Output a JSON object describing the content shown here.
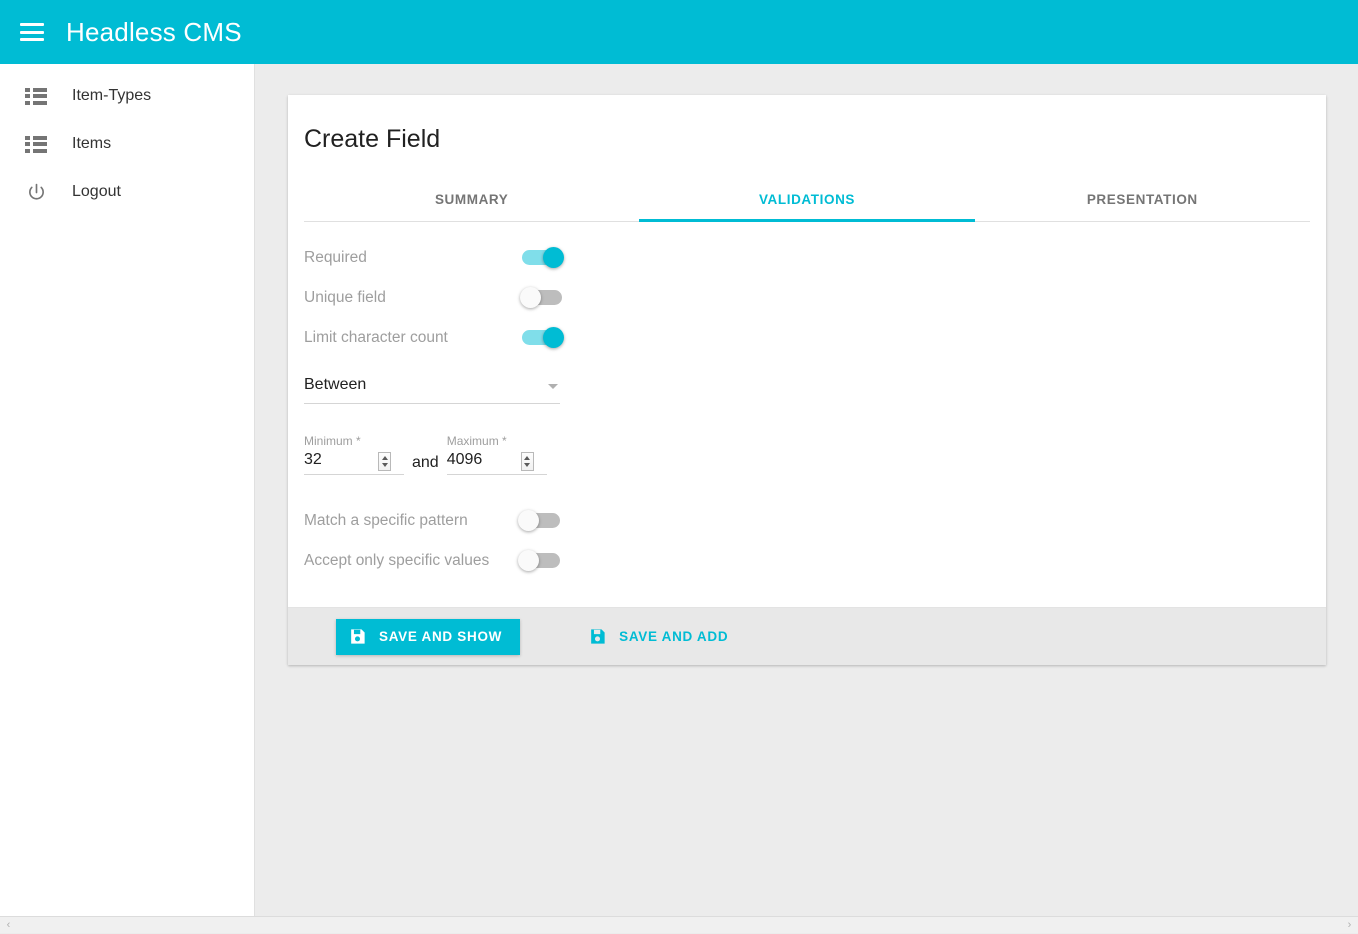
{
  "appbar": {
    "title": "Headless CMS",
    "menu_icon": "hamburger-icon",
    "brand_color": "#00bcd4"
  },
  "sidebar": {
    "items": [
      {
        "label": "Item-Types",
        "icon": "list-icon"
      },
      {
        "label": "Items",
        "icon": "list-icon"
      },
      {
        "label": "Logout",
        "icon": "power-icon"
      }
    ]
  },
  "card": {
    "title": "Create Field",
    "tabs": [
      {
        "label": "SUMMARY",
        "active": false
      },
      {
        "label": "VALIDATIONS",
        "active": true
      },
      {
        "label": "PRESENTATION",
        "active": false
      }
    ],
    "switches_top": [
      {
        "label": "Required",
        "state": "on"
      },
      {
        "label": "Unique field",
        "state": "off"
      },
      {
        "label": "Limit character count",
        "state": "on"
      }
    ],
    "limit_mode": {
      "value": "Between",
      "caret_icon": "chevron-down-icon"
    },
    "range": {
      "min_label": "Minimum *",
      "min_value": "32",
      "conjunction": "and",
      "max_label": "Maximum *",
      "max_value": "4096"
    },
    "switches_bottom": [
      {
        "label": "Match a specific pattern",
        "state": "off"
      },
      {
        "label": "Accept only specific values",
        "state": "off"
      }
    ],
    "footer": {
      "save_show_label": "SAVE AND SHOW",
      "save_add_label": "SAVE AND ADD",
      "save_icon": "floppy-disk-icon"
    }
  },
  "scrollbar": {
    "left_arrow": "‹",
    "right_arrow": "›"
  }
}
